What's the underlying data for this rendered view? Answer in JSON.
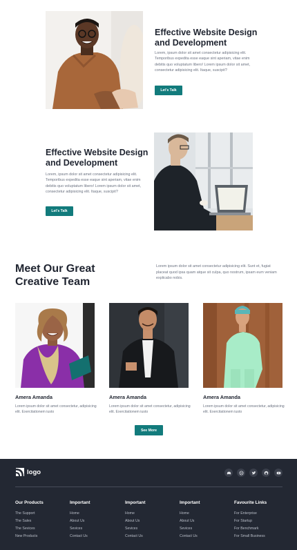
{
  "features": [
    {
      "title": "Effective Website Design and Development",
      "text": "Lorem, ipsum dolor sit amet consectetur adipisicing elit. Temporibus expedita esse eaque sint aperiam, vitae enim debitis quo voluptatum libero! Lorem ipsum dolor sit amet, consectetur adipisicing elit. Itaque, suscipit?",
      "button": "Let's Talk"
    },
    {
      "title": "Effective Website Design and Development",
      "text": "Lorem, ipsum dolor sit amet consectetur adipisicing elit. Temporibus expedita esse eaque sint aperiam, vitae enim debitis quo voluptatum libero! Lorem ipsum dolor sit amet, consectetur adipisicing elit. Itaque, suscipit?",
      "button": "Let's Talk"
    }
  ],
  "team": {
    "title": "Meet Our Great Creative Team",
    "description": "Lorem ipsum dolor sit amet consectetur adipisicing elit. Sunt et, fugiat placeat quod ipsa quam atque sit culpa, quo nostrum, ipsam eum veniam explicabo nobis.",
    "members": [
      {
        "name": "Amera Amanda",
        "bio": "Lorem ipsum dolor sit amet consectetur, adipisicing elit. Exercitationem iusto"
      },
      {
        "name": "Amera Amanda",
        "bio": "Lorem ipsum dolor sit amet consectetur, adipisicing elit. Exercitationem iusto"
      },
      {
        "name": "Amera Amanda",
        "bio": "Lorem ipsum dolor sit amet consectetur, adipisicing elit. Exercitationem iusto"
      }
    ],
    "button": "See More"
  },
  "footer": {
    "logo": "logo",
    "social_icons": [
      "discord-icon",
      "dribbble-icon",
      "twitter-icon",
      "github-icon",
      "youtube-icon"
    ],
    "columns": [
      {
        "heading": "Our Products",
        "links": [
          "The Support",
          "The Sales",
          "The Sevices",
          "New Products"
        ]
      },
      {
        "heading": "Important",
        "links": [
          "Home",
          "About Us",
          "Sevices",
          "Contact Us"
        ]
      },
      {
        "heading": "Important",
        "links": [
          "Home",
          "About Us",
          "Sevices",
          "Contact Us"
        ]
      },
      {
        "heading": "Important",
        "links": [
          "Home",
          "About Us",
          "Sevices",
          "Contact Us"
        ]
      },
      {
        "heading": "Favourite Links",
        "links": [
          "For Enterprise",
          "For Startup",
          "For Benchmark",
          "For Small Business"
        ]
      }
    ]
  },
  "colors": {
    "accent": "#127b7c",
    "footer_bg": "#232833",
    "heading": "#1f2430",
    "body_text": "#6b7280"
  }
}
